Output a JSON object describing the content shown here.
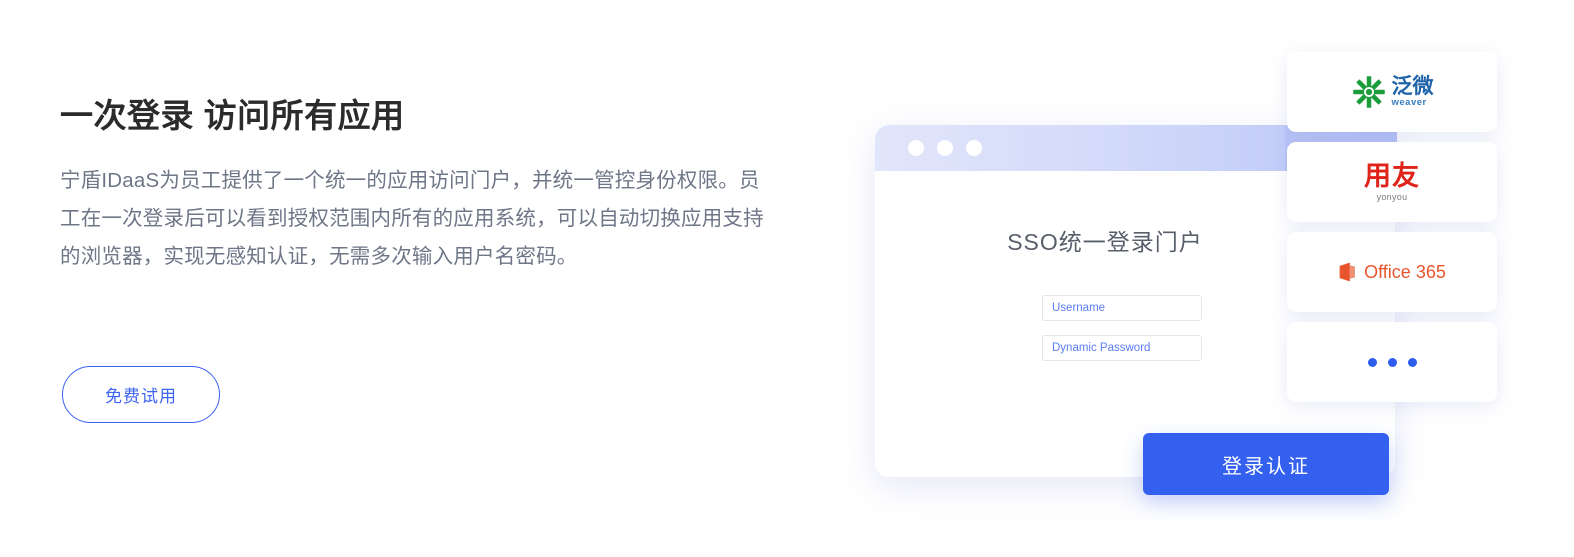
{
  "left_panel": {
    "headline": "一次登录 访问所有应用",
    "paragraph": "宁盾IDaaS为员工提供了一个统一的应用访问门户，并统一管控身份权限。员工在一次登录后可以看到授权范围内所有的应用系统，可以自动切换应用支持的浏览器，实现无感知认证，无需多次输入用户名密码。",
    "cta_label": "免费试用"
  },
  "illustration": {
    "browser": {
      "window_dots_count": 3,
      "sso_title": "SSO统一登录门户",
      "fields": [
        {
          "name": "username",
          "placeholder": "Username",
          "value": ""
        },
        {
          "name": "dynamic-password",
          "placeholder": "Dynamic Password",
          "value": ""
        }
      ],
      "login_button_label": "登录认证"
    },
    "app_cards": [
      {
        "id": "weaver",
        "cn": "泛微",
        "en": "weaver",
        "mark_color": "#1a9c3a",
        "text_color": "#1f63a8"
      },
      {
        "id": "yonyou",
        "cn": "用友",
        "en": "yonyou",
        "text_color": "#e02318"
      },
      {
        "id": "office365",
        "text": "Office 365",
        "text_color": "#e8552c"
      },
      {
        "id": "more",
        "dots_count": 3,
        "dot_color": "#2c5cf0"
      }
    ]
  },
  "colors": {
    "accent_blue": "#3360ee",
    "outline_blue": "#3b63f0",
    "headline": "#2b2b2b",
    "body_text": "#6e7687",
    "titlebar_from": "#e2e6fb",
    "titlebar_to": "#b8c3f7",
    "field_placeholder": "#5a7df5"
  }
}
